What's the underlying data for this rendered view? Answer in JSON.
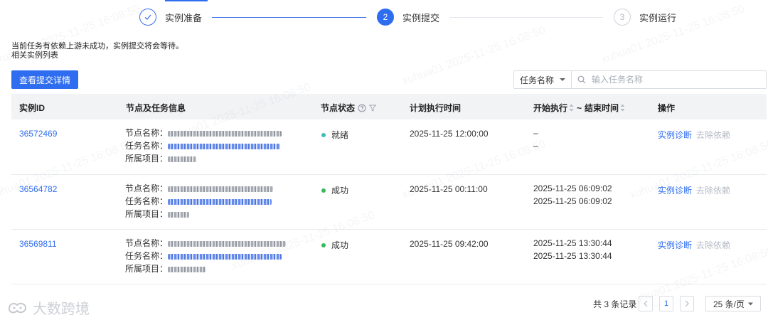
{
  "steps": [
    {
      "label": "实例准备",
      "state": "done",
      "icon": "check-icon"
    },
    {
      "label": "实例提交",
      "state": "active",
      "number": "2"
    },
    {
      "label": "实例运行",
      "state": "todo",
      "number": "3"
    }
  ],
  "notice": {
    "line1": "当前任务有依赖上游未成功，实例提交将会等待。",
    "line2": "相关实例列表"
  },
  "toolbar": {
    "details_button": "查看提交详情",
    "filter_field": "任务名称",
    "search_placeholder": "输入任务名称"
  },
  "table": {
    "headers": {
      "id": "实例ID",
      "info": "节点及任务信息",
      "status": "节点状态",
      "planned": "计划执行时间",
      "start": "开始执行",
      "separator": "~",
      "end": "结束时间",
      "ops": "操作"
    },
    "info_keys": {
      "node": "节点名称：",
      "task": "任务名称：",
      "project": "所属项目："
    },
    "rows": [
      {
        "id": "36572469",
        "status": "就绪",
        "status_color": "#3cc0b4",
        "planned": "2025-11-25 12:00:00",
        "start": "–",
        "end": "–",
        "op_diagnose": "实例诊断",
        "op_remove": "去除依赖"
      },
      {
        "id": "36564782",
        "status": "成功",
        "status_color": "#35b95c",
        "planned": "2025-11-25 00:11:00",
        "start": "2025-11-25 06:09:02",
        "end": "2025-11-25 06:09:02",
        "op_diagnose": "实例诊断",
        "op_remove": "去除依赖"
      },
      {
        "id": "36569811",
        "status": "成功",
        "status_color": "#35b95c",
        "planned": "2025-11-25 09:42:00",
        "start": "2025-11-25 13:30:44",
        "end": "2025-11-25 13:30:44",
        "op_diagnose": "实例诊断",
        "op_remove": "去除依赖"
      }
    ]
  },
  "pagination": {
    "total": "共 3 条记录",
    "current_page": "1",
    "page_size": "25 条/页"
  },
  "watermark": {
    "text": "xuhua01 2025-11-25 16:08:50",
    "brand": "大数跨境"
  },
  "colors": {
    "primary": "#2f6df0",
    "success": "#35b95c",
    "ready": "#3cc0b4",
    "disabled": "#b6bbc4"
  }
}
